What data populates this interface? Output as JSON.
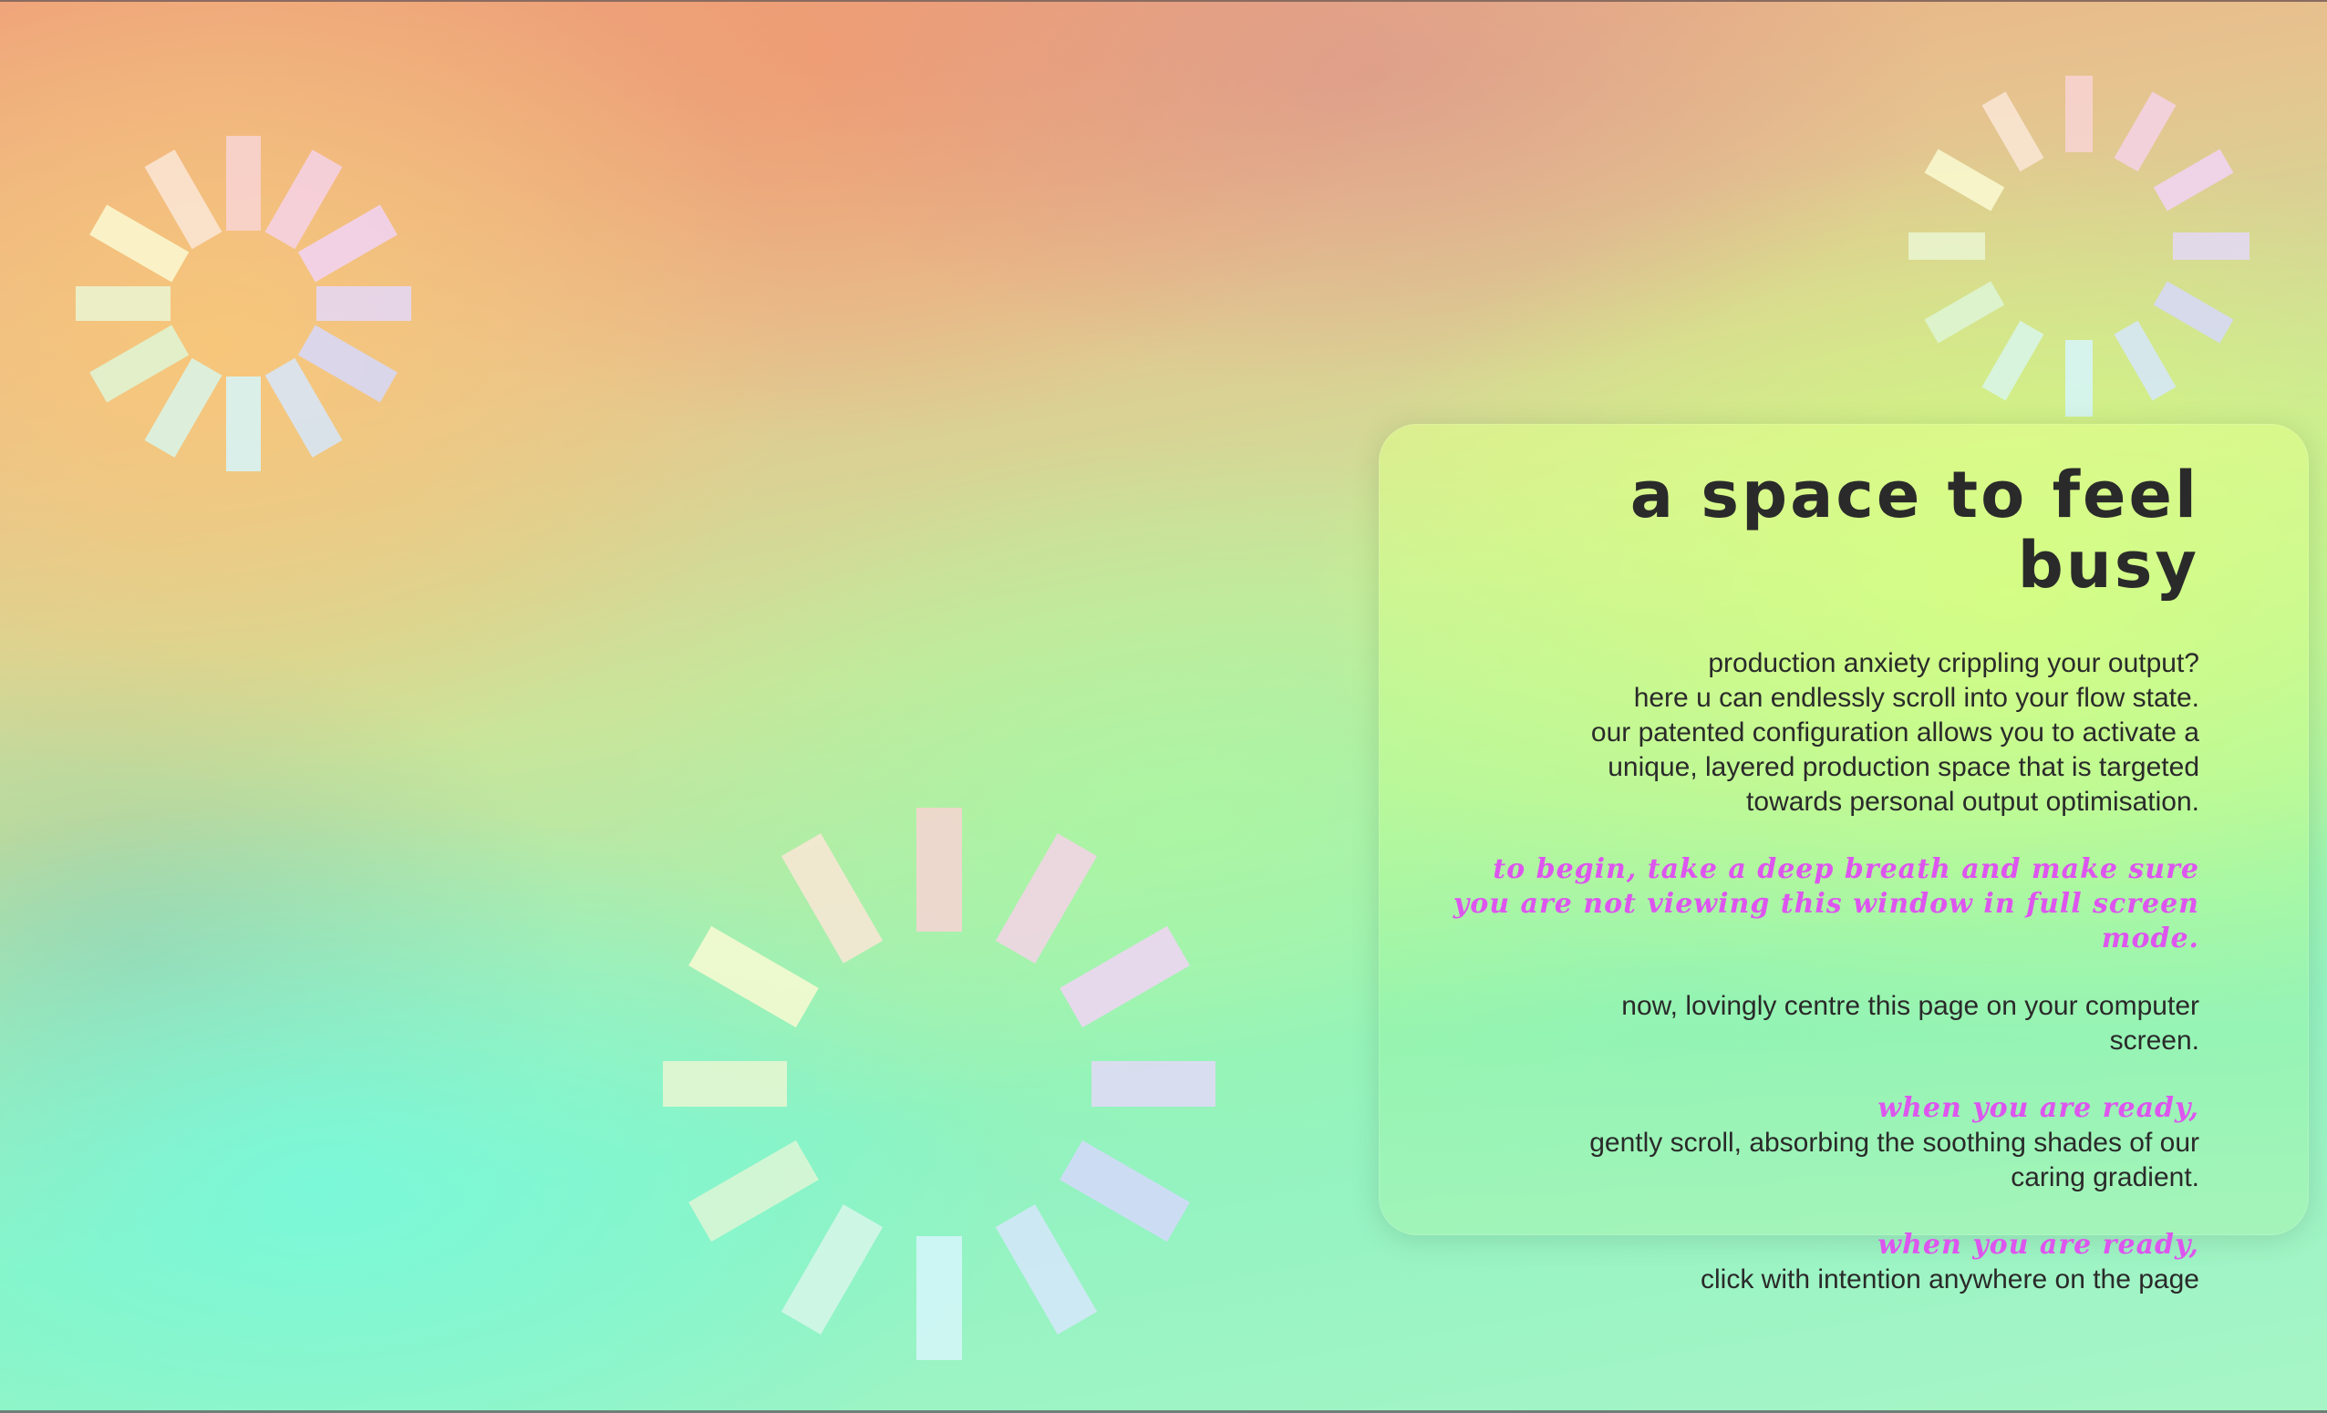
{
  "colors": {
    "accent": "#dd55ee",
    "text": "#2a2a2a",
    "spinner_bars": [
      "#f8d4d4",
      "#f6d2e8",
      "#f2d4f6",
      "#e4d8f8",
      "#d6d8fb",
      "#d6e6fb",
      "#d6f6fb",
      "#d8f6ea",
      "#def6d6",
      "#eaf6d2",
      "#fafad2",
      "#fae6d6"
    ]
  },
  "icons": [
    "loading-spinner-icon"
  ],
  "card": {
    "title": "a space to feel busy",
    "intro_lines": [
      "production anxiety crippling your output?",
      "here u can endlessly scroll into your flow state.",
      "our patented configuration allows you to activate a",
      "unique, layered production space that is targeted",
      "towards personal output optimisation."
    ],
    "instruction_lines": [
      "to begin, take a deep breath and make sure",
      "you are not viewing this window in full screen",
      "mode."
    ],
    "centre_lines": [
      "now, lovingly centre this page on your computer",
      "screen."
    ],
    "ready_1": "when you are ready,",
    "scroll_lines": [
      "gently scroll, absorbing the soothing shades of our",
      "caring gradient."
    ],
    "ready_2": "when you are ready,",
    "click_line": "click with intention anywhere on the page"
  }
}
